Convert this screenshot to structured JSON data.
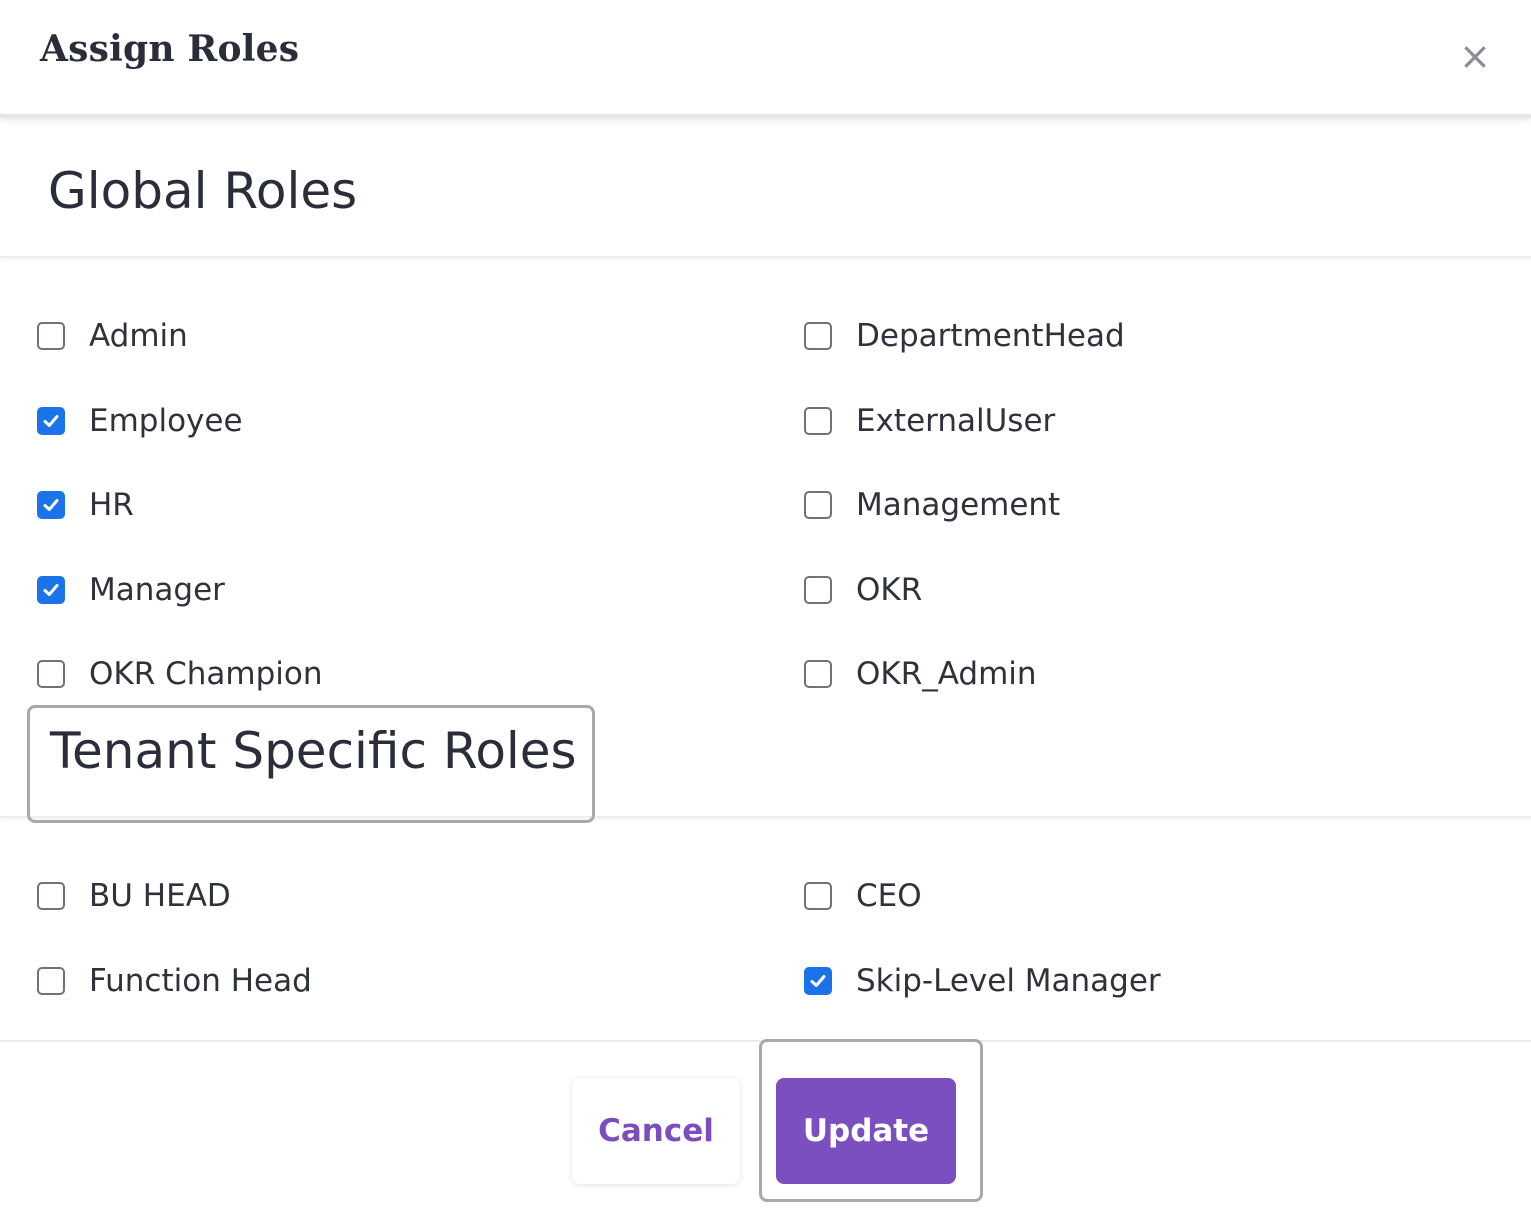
{
  "dialog": {
    "title": "Assign Roles",
    "close_glyph": "×"
  },
  "global_roles": {
    "heading": "Global Roles",
    "items": [
      {
        "label": "Admin",
        "checked": false
      },
      {
        "label": "DepartmentHead",
        "checked": false
      },
      {
        "label": "Employee",
        "checked": true
      },
      {
        "label": "ExternalUser",
        "checked": false
      },
      {
        "label": "HR",
        "checked": true
      },
      {
        "label": "Management",
        "checked": false
      },
      {
        "label": "Manager",
        "checked": true
      },
      {
        "label": "OKR",
        "checked": false
      },
      {
        "label": "OKR Champion",
        "checked": false
      },
      {
        "label": "OKR_Admin",
        "checked": false
      }
    ]
  },
  "tenant_roles": {
    "heading": "Tenant Specific Roles",
    "items": [
      {
        "label": "BU HEAD",
        "checked": false
      },
      {
        "label": "CEO",
        "checked": false
      },
      {
        "label": "Function Head",
        "checked": false
      },
      {
        "label": "Skip-Level Manager",
        "checked": true
      }
    ]
  },
  "footer": {
    "cancel_label": "Cancel",
    "update_label": "Update"
  },
  "colors": {
    "accent": "#7b4fc0",
    "checkbox_checked": "#1a73e8"
  }
}
